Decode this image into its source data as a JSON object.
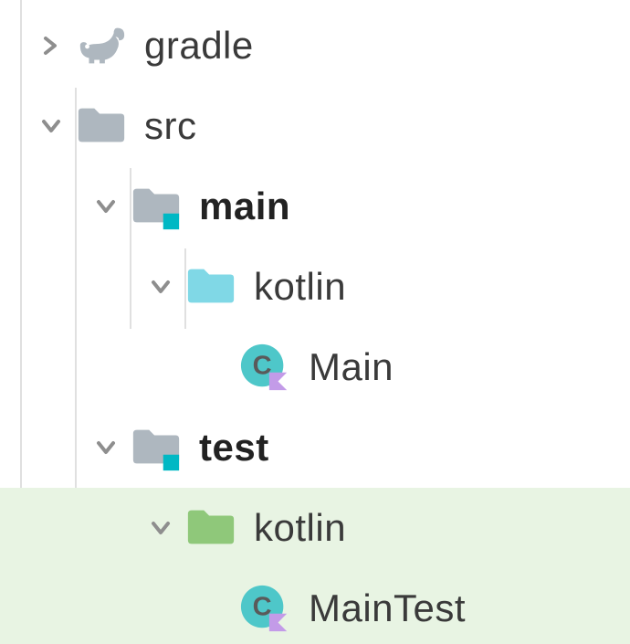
{
  "tree": {
    "gradle": {
      "label": "gradle",
      "expanded": false,
      "icon": "gradle-icon"
    },
    "src": {
      "label": "src",
      "expanded": true,
      "icon": "folder-gray",
      "main": {
        "label": "main",
        "expanded": true,
        "bold": true,
        "icon": "folder-gray-marked",
        "kotlin": {
          "label": "kotlin",
          "expanded": true,
          "icon": "folder-cyan",
          "Main": {
            "label": "Main",
            "icon": "kotlin-class"
          }
        }
      },
      "test": {
        "label": "test",
        "expanded": true,
        "bold": true,
        "icon": "folder-gray-marked",
        "kotlin": {
          "label": "kotlin",
          "expanded": true,
          "icon": "folder-green",
          "selected": true,
          "MainTest": {
            "label": "MainTest",
            "icon": "kotlin-class",
            "selected": true
          }
        }
      }
    }
  },
  "colors": {
    "chevron": "#8e8e8e",
    "folderGray": "#aeb7bf",
    "folderCyan": "#80d8e6",
    "folderGreen": "#8fc87a",
    "marker": "#00b8c4",
    "kotlinCircle": "#4ec7c9",
    "kotlinFlag": "#c39be8",
    "selectedBg": "#e8f4e3"
  },
  "icons": {
    "gradle": "gradle-icon",
    "folder_gray": "folder-gray-icon",
    "folder_gray_marked": "folder-gray-marked-icon",
    "folder_cyan": "folder-cyan-icon",
    "folder_green": "folder-green-icon",
    "kotlin_class": "kotlin-class-icon",
    "chevron_right": "chevron-right-icon",
    "chevron_down": "chevron-down-icon"
  }
}
